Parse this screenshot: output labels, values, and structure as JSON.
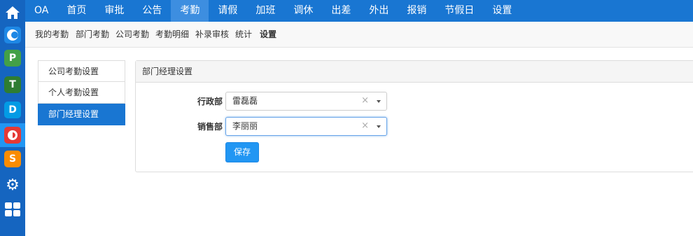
{
  "sidebar": {
    "items": [
      {
        "icon": "home-icon",
        "glyph": "",
        "color": "transparent"
      },
      {
        "icon": "app-c-icon",
        "glyph": "C",
        "color": "#1e88e5"
      },
      {
        "icon": "app-p-icon",
        "glyph": "P",
        "color": "#43a047"
      },
      {
        "icon": "app-t-icon",
        "glyph": "T",
        "color": "#2e7d32"
      },
      {
        "icon": "app-d-icon",
        "glyph": "D",
        "color": "#039be5"
      },
      {
        "icon": "app-o-icon",
        "glyph": "O",
        "color": "#e53935"
      },
      {
        "icon": "app-s-icon",
        "glyph": "S",
        "color": "#fb8c00"
      },
      {
        "icon": "gear-icon",
        "glyph": "⚙",
        "color": "transparent"
      },
      {
        "icon": "grid-icon",
        "glyph": "",
        "color": "transparent"
      }
    ]
  },
  "topnav": {
    "items": [
      "OA",
      "首页",
      "审批",
      "公告",
      "考勤",
      "请假",
      "加班",
      "调休",
      "出差",
      "外出",
      "报销",
      "节假日",
      "设置"
    ],
    "active_index": 4
  },
  "subnav": {
    "items": [
      "我的考勤",
      "部门考勤",
      "公司考勤",
      "考勤明细",
      "补录审核",
      "统计",
      "设置"
    ],
    "active_index": 6
  },
  "settings_menu": {
    "items": [
      "公司考勤设置",
      "个人考勤设置",
      "部门经理设置"
    ],
    "active_index": 2
  },
  "panel": {
    "title": "部门经理设置",
    "rows": [
      {
        "label": "行政部",
        "value": "雷磊磊",
        "clear": "×"
      },
      {
        "label": "销售部",
        "value": "李丽丽",
        "clear": "×"
      }
    ],
    "save_label": "保存"
  },
  "colors": {
    "topbar": "#1976d2",
    "sidebar": "#1565c0",
    "accent": "#2196f3"
  }
}
